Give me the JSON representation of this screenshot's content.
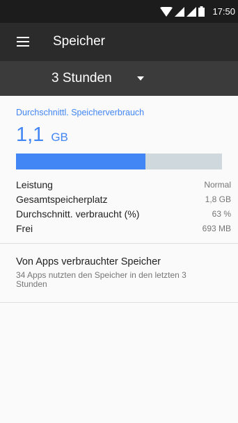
{
  "status_bar": {
    "time": "17:50",
    "icons": [
      "wifi-icon",
      "signal-icon",
      "signal-icon",
      "battery-icon"
    ]
  },
  "app_bar": {
    "title": "Speicher",
    "menu_icon": "menu-icon"
  },
  "time_range": {
    "selected": "3 Stunden"
  },
  "memory": {
    "section_title": "Durchschnittl. Speicherverbrauch",
    "average_value": "1,1",
    "average_unit": "GB",
    "usage_fraction": 0.63,
    "colors": {
      "accent": "#4285f4",
      "track": "#cfd8dc"
    },
    "stats": [
      {
        "label": "Leistung",
        "value": "Normal"
      },
      {
        "label": "Gesamtspeicherplatz",
        "value": "1,8 GB"
      },
      {
        "label": "Durchschnitt. verbraucht (%)",
        "value": "63 %"
      },
      {
        "label": "Frei",
        "value": "693 MB"
      }
    ]
  },
  "apps_memory": {
    "title": "Von Apps verbrauchter Speicher",
    "subtitle": "34 Apps nutzten den Speicher in den letzten 3 Stunden"
  }
}
